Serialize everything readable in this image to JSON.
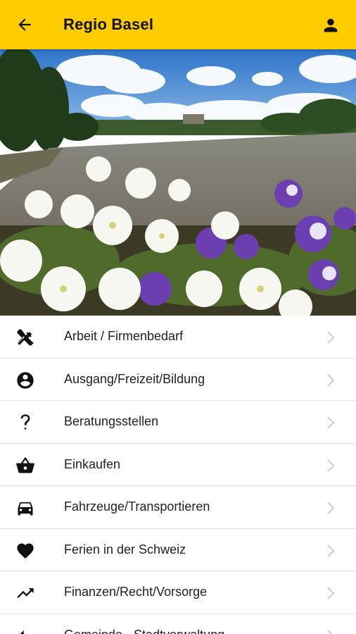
{
  "appbar": {
    "title": "Regio Basel",
    "back_icon": "arrow-back-icon",
    "account_icon": "person-icon",
    "color": "#FFCC00"
  },
  "hero": {
    "description_icon": "rhine-river-flowers-photo"
  },
  "list": {
    "items": [
      {
        "label": "Arbeit / Firmenbedarf",
        "icon": "tools-icon"
      },
      {
        "label": "Ausgang/Freizeit/Bildung",
        "icon": "account-circle-icon"
      },
      {
        "label": "Beratungsstellen",
        "icon": "question-mark-icon"
      },
      {
        "label": "Einkaufen",
        "icon": "shopping-basket-icon"
      },
      {
        "label": "Fahrzeuge/Transportieren",
        "icon": "car-icon"
      },
      {
        "label": "Ferien in der Schweiz",
        "icon": "heart-icon"
      },
      {
        "label": "Finanzen/Recht/Vorsorge",
        "icon": "trending-up-icon"
      },
      {
        "label": "Gemeinde - Stadtverwaltung",
        "icon": "undo-arrow-icon"
      }
    ],
    "chevron_icon": "chevron-right-icon"
  }
}
